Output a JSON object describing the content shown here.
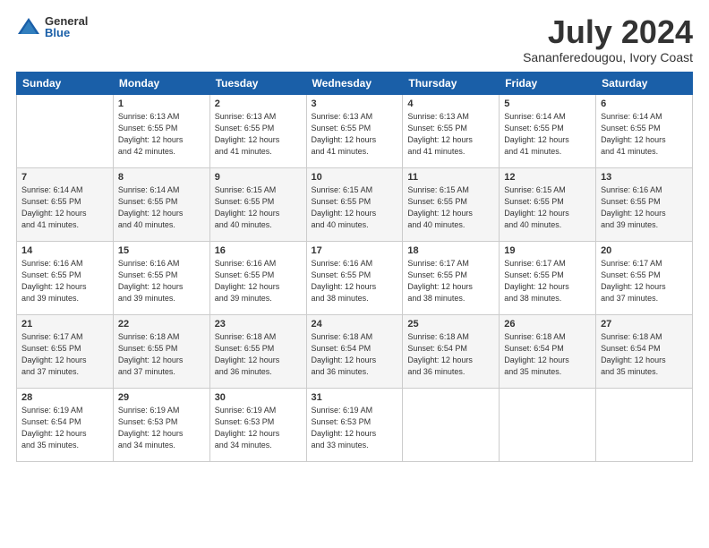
{
  "header": {
    "logo": {
      "general": "General",
      "blue": "Blue"
    },
    "title": "July 2024",
    "subtitle": "Sananferedougou, Ivory Coast"
  },
  "days": [
    "Sunday",
    "Monday",
    "Tuesday",
    "Wednesday",
    "Thursday",
    "Friday",
    "Saturday"
  ],
  "weeks": [
    [
      {
        "date": "",
        "sunrise": "",
        "sunset": "",
        "daylight": ""
      },
      {
        "date": "1",
        "sunrise": "Sunrise: 6:13 AM",
        "sunset": "Sunset: 6:55 PM",
        "daylight": "Daylight: 12 hours and 42 minutes."
      },
      {
        "date": "2",
        "sunrise": "Sunrise: 6:13 AM",
        "sunset": "Sunset: 6:55 PM",
        "daylight": "Daylight: 12 hours and 41 minutes."
      },
      {
        "date": "3",
        "sunrise": "Sunrise: 6:13 AM",
        "sunset": "Sunset: 6:55 PM",
        "daylight": "Daylight: 12 hours and 41 minutes."
      },
      {
        "date": "4",
        "sunrise": "Sunrise: 6:13 AM",
        "sunset": "Sunset: 6:55 PM",
        "daylight": "Daylight: 12 hours and 41 minutes."
      },
      {
        "date": "5",
        "sunrise": "Sunrise: 6:14 AM",
        "sunset": "Sunset: 6:55 PM",
        "daylight": "Daylight: 12 hours and 41 minutes."
      },
      {
        "date": "6",
        "sunrise": "Sunrise: 6:14 AM",
        "sunset": "Sunset: 6:55 PM",
        "daylight": "Daylight: 12 hours and 41 minutes."
      }
    ],
    [
      {
        "date": "7",
        "sunrise": "Sunrise: 6:14 AM",
        "sunset": "Sunset: 6:55 PM",
        "daylight": "Daylight: 12 hours and 41 minutes."
      },
      {
        "date": "8",
        "sunrise": "Sunrise: 6:14 AM",
        "sunset": "Sunset: 6:55 PM",
        "daylight": "Daylight: 12 hours and 40 minutes."
      },
      {
        "date": "9",
        "sunrise": "Sunrise: 6:15 AM",
        "sunset": "Sunset: 6:55 PM",
        "daylight": "Daylight: 12 hours and 40 minutes."
      },
      {
        "date": "10",
        "sunrise": "Sunrise: 6:15 AM",
        "sunset": "Sunset: 6:55 PM",
        "daylight": "Daylight: 12 hours and 40 minutes."
      },
      {
        "date": "11",
        "sunrise": "Sunrise: 6:15 AM",
        "sunset": "Sunset: 6:55 PM",
        "daylight": "Daylight: 12 hours and 40 minutes."
      },
      {
        "date": "12",
        "sunrise": "Sunrise: 6:15 AM",
        "sunset": "Sunset: 6:55 PM",
        "daylight": "Daylight: 12 hours and 40 minutes."
      },
      {
        "date": "13",
        "sunrise": "Sunrise: 6:16 AM",
        "sunset": "Sunset: 6:55 PM",
        "daylight": "Daylight: 12 hours and 39 minutes."
      }
    ],
    [
      {
        "date": "14",
        "sunrise": "Sunrise: 6:16 AM",
        "sunset": "Sunset: 6:55 PM",
        "daylight": "Daylight: 12 hours and 39 minutes."
      },
      {
        "date": "15",
        "sunrise": "Sunrise: 6:16 AM",
        "sunset": "Sunset: 6:55 PM",
        "daylight": "Daylight: 12 hours and 39 minutes."
      },
      {
        "date": "16",
        "sunrise": "Sunrise: 6:16 AM",
        "sunset": "Sunset: 6:55 PM",
        "daylight": "Daylight: 12 hours and 39 minutes."
      },
      {
        "date": "17",
        "sunrise": "Sunrise: 6:16 AM",
        "sunset": "Sunset: 6:55 PM",
        "daylight": "Daylight: 12 hours and 38 minutes."
      },
      {
        "date": "18",
        "sunrise": "Sunrise: 6:17 AM",
        "sunset": "Sunset: 6:55 PM",
        "daylight": "Daylight: 12 hours and 38 minutes."
      },
      {
        "date": "19",
        "sunrise": "Sunrise: 6:17 AM",
        "sunset": "Sunset: 6:55 PM",
        "daylight": "Daylight: 12 hours and 38 minutes."
      },
      {
        "date": "20",
        "sunrise": "Sunrise: 6:17 AM",
        "sunset": "Sunset: 6:55 PM",
        "daylight": "Daylight: 12 hours and 37 minutes."
      }
    ],
    [
      {
        "date": "21",
        "sunrise": "Sunrise: 6:17 AM",
        "sunset": "Sunset: 6:55 PM",
        "daylight": "Daylight: 12 hours and 37 minutes."
      },
      {
        "date": "22",
        "sunrise": "Sunrise: 6:18 AM",
        "sunset": "Sunset: 6:55 PM",
        "daylight": "Daylight: 12 hours and 37 minutes."
      },
      {
        "date": "23",
        "sunrise": "Sunrise: 6:18 AM",
        "sunset": "Sunset: 6:55 PM",
        "daylight": "Daylight: 12 hours and 36 minutes."
      },
      {
        "date": "24",
        "sunrise": "Sunrise: 6:18 AM",
        "sunset": "Sunset: 6:54 PM",
        "daylight": "Daylight: 12 hours and 36 minutes."
      },
      {
        "date": "25",
        "sunrise": "Sunrise: 6:18 AM",
        "sunset": "Sunset: 6:54 PM",
        "daylight": "Daylight: 12 hours and 36 minutes."
      },
      {
        "date": "26",
        "sunrise": "Sunrise: 6:18 AM",
        "sunset": "Sunset: 6:54 PM",
        "daylight": "Daylight: 12 hours and 35 minutes."
      },
      {
        "date": "27",
        "sunrise": "Sunrise: 6:18 AM",
        "sunset": "Sunset: 6:54 PM",
        "daylight": "Daylight: 12 hours and 35 minutes."
      }
    ],
    [
      {
        "date": "28",
        "sunrise": "Sunrise: 6:19 AM",
        "sunset": "Sunset: 6:54 PM",
        "daylight": "Daylight: 12 hours and 35 minutes."
      },
      {
        "date": "29",
        "sunrise": "Sunrise: 6:19 AM",
        "sunset": "Sunset: 6:53 PM",
        "daylight": "Daylight: 12 hours and 34 minutes."
      },
      {
        "date": "30",
        "sunrise": "Sunrise: 6:19 AM",
        "sunset": "Sunset: 6:53 PM",
        "daylight": "Daylight: 12 hours and 34 minutes."
      },
      {
        "date": "31",
        "sunrise": "Sunrise: 6:19 AM",
        "sunset": "Sunset: 6:53 PM",
        "daylight": "Daylight: 12 hours and 33 minutes."
      },
      {
        "date": "",
        "sunrise": "",
        "sunset": "",
        "daylight": ""
      },
      {
        "date": "",
        "sunrise": "",
        "sunset": "",
        "daylight": ""
      },
      {
        "date": "",
        "sunrise": "",
        "sunset": "",
        "daylight": ""
      }
    ]
  ]
}
